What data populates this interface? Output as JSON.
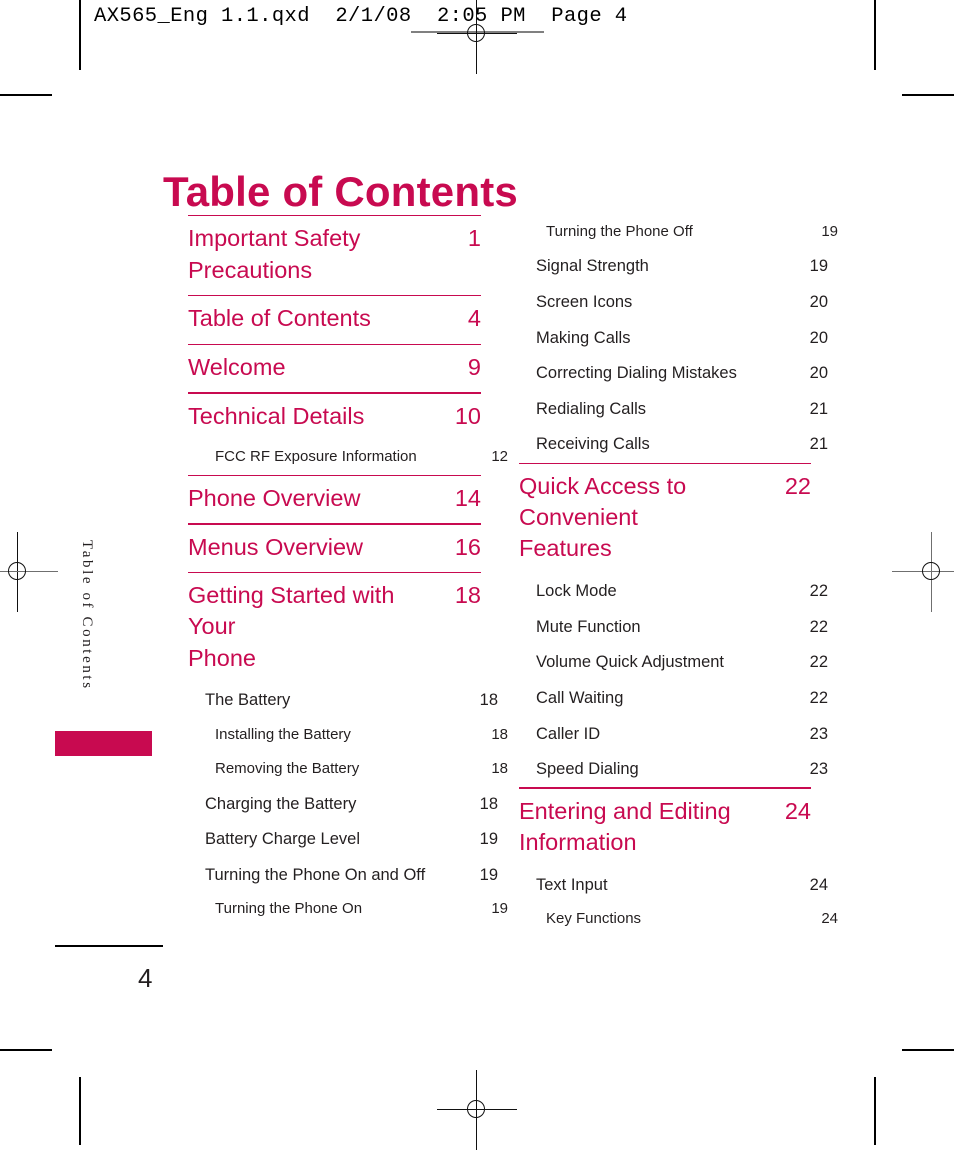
{
  "header": {
    "file_info": "AX565_Eng 1.1.qxd  2/1/08  2:05 PM  Page 4"
  },
  "side_tab": {
    "label": "Table  of  Contents"
  },
  "title": "Table of Contents",
  "footer": {
    "page_number": "4"
  },
  "colors": {
    "accent": "#c80a50",
    "body_text": "#231f20",
    "rule": "#c80a50"
  },
  "columns": {
    "left": [
      {
        "level": 0,
        "label": "Important Safety\nPrecautions",
        "page": "1",
        "rule_above": true
      },
      {
        "level": 0,
        "label": "Table of Contents",
        "page": "4",
        "rule_above": true
      },
      {
        "level": 0,
        "label": "Welcome",
        "page": "9",
        "rule_above": true
      },
      {
        "level": 0,
        "label": "Technical Details",
        "page": "10",
        "rule_above": true
      },
      {
        "level": 2,
        "label": "FCC RF Exposure Information",
        "page": "12",
        "rule_above": false
      },
      {
        "level": 0,
        "label": "Phone Overview",
        "page": "14",
        "rule_above": true
      },
      {
        "level": 0,
        "label": "Menus Overview",
        "page": "16",
        "rule_above": true
      },
      {
        "level": 0,
        "label": "Getting Started with Your\nPhone",
        "page": "18",
        "rule_above": true
      },
      {
        "level": 1,
        "label": "The Battery",
        "page": "18",
        "rule_above": false
      },
      {
        "level": 2,
        "label": "Installing the Battery",
        "page": "18",
        "rule_above": false
      },
      {
        "level": 2,
        "label": "Removing the Battery",
        "page": "18",
        "rule_above": false
      },
      {
        "level": 1,
        "label": "Charging the Battery",
        "page": "18",
        "rule_above": false
      },
      {
        "level": 1,
        "label": "Battery Charge Level",
        "page": "19",
        "rule_above": false
      },
      {
        "level": 1,
        "label": "Turning the Phone On and Off",
        "page": "19",
        "rule_above": false
      },
      {
        "level": 2,
        "label": "Turning the Phone On",
        "page": "19",
        "rule_above": false
      }
    ],
    "right": [
      {
        "level": 2,
        "label": "Turning the Phone Off",
        "page": "19",
        "rule_above": false
      },
      {
        "level": 1,
        "label": "Signal Strength",
        "page": "19",
        "rule_above": false
      },
      {
        "level": 1,
        "label": "Screen Icons",
        "page": "20",
        "rule_above": false
      },
      {
        "level": 1,
        "label": "Making Calls",
        "page": "20",
        "rule_above": false
      },
      {
        "level": 1,
        "label": "Correcting Dialing Mistakes",
        "page": "20",
        "rule_above": false
      },
      {
        "level": 1,
        "label": "Redialing Calls",
        "page": "21",
        "rule_above": false
      },
      {
        "level": 1,
        "label": "Receiving Calls",
        "page": "21",
        "rule_above": false
      },
      {
        "level": 0,
        "label": "Quick Access to Convenient\nFeatures",
        "page": "22",
        "rule_above": true
      },
      {
        "level": 1,
        "label": "Lock Mode",
        "page": "22",
        "rule_above": false
      },
      {
        "level": 1,
        "label": "Mute Function",
        "page": "22",
        "rule_above": false
      },
      {
        "level": 1,
        "label": "Volume Quick Adjustment",
        "page": "22",
        "rule_above": false
      },
      {
        "level": 1,
        "label": "Call Waiting",
        "page": "22",
        "rule_above": false
      },
      {
        "level": 1,
        "label": "Caller ID",
        "page": "23",
        "rule_above": false
      },
      {
        "level": 1,
        "label": "Speed Dialing",
        "page": "23",
        "rule_above": false
      },
      {
        "level": 0,
        "label": "Entering and Editing\nInformation",
        "page": "24",
        "rule_above": true
      },
      {
        "level": 1,
        "label": "Text Input",
        "page": "24",
        "rule_above": false
      },
      {
        "level": 2,
        "label": "Key Functions",
        "page": "24",
        "rule_above": false
      }
    ]
  }
}
